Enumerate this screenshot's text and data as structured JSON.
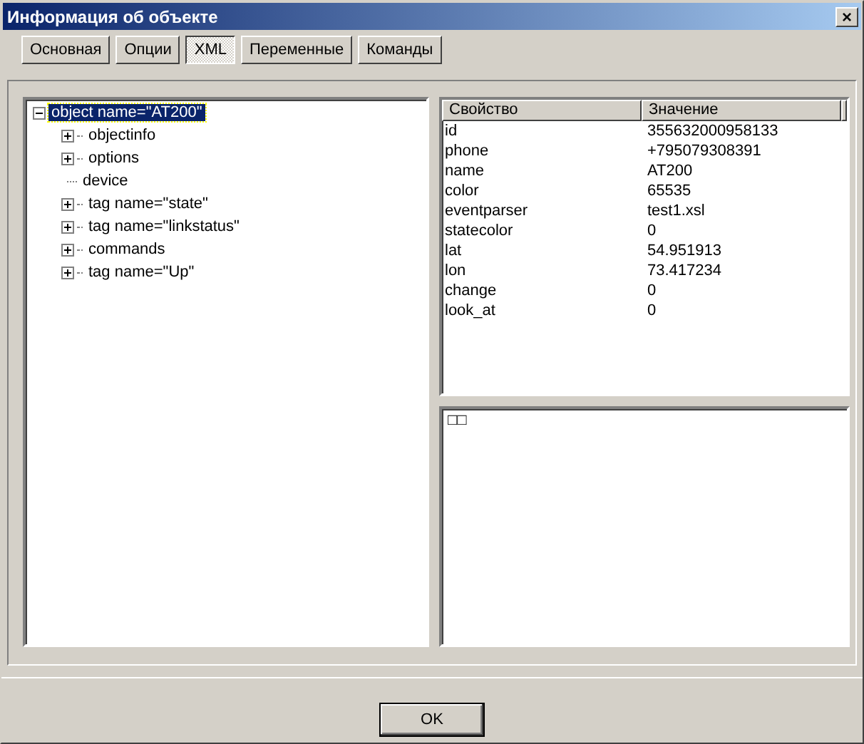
{
  "window": {
    "title": "Информация об объекте",
    "close": "×"
  },
  "tabs": [
    {
      "label": "Основная",
      "selected": false
    },
    {
      "label": "Опции",
      "selected": false
    },
    {
      "label": "XML",
      "selected": true
    },
    {
      "label": "Переменные",
      "selected": false
    },
    {
      "label": "Команды",
      "selected": false
    }
  ],
  "tree": {
    "label": "object name=\"AT200\"",
    "expanded": true,
    "selected": true,
    "children": [
      {
        "label": "objectinfo",
        "kind": "branch",
        "expanded": false
      },
      {
        "label": "options",
        "kind": "branch",
        "expanded": false
      },
      {
        "label": "device",
        "kind": "leaf"
      },
      {
        "label": "tag name=\"state\"",
        "kind": "branch",
        "expanded": false
      },
      {
        "label": "tag name=\"linkstatus\"",
        "kind": "branch",
        "expanded": false
      },
      {
        "label": "commands",
        "kind": "branch",
        "expanded": false
      },
      {
        "label": "tag name=\"Up\"",
        "kind": "branch",
        "expanded": false
      }
    ]
  },
  "table": {
    "columns": [
      "Свойство",
      "Значение"
    ],
    "rows": [
      [
        "id",
        "355632000958133"
      ],
      [
        "phone",
        "+795079308391"
      ],
      [
        "name",
        "AT200"
      ],
      [
        "color",
        "65535"
      ],
      [
        "eventparser",
        "test1.xsl"
      ],
      [
        "statecolor",
        "0"
      ],
      [
        "lat",
        "54.951913"
      ],
      [
        "lon",
        "73.417234"
      ],
      [
        "change",
        "0"
      ],
      [
        "look_at",
        "0"
      ]
    ]
  },
  "preview": {
    "text": "□□"
  },
  "buttons": [
    "OK"
  ]
}
